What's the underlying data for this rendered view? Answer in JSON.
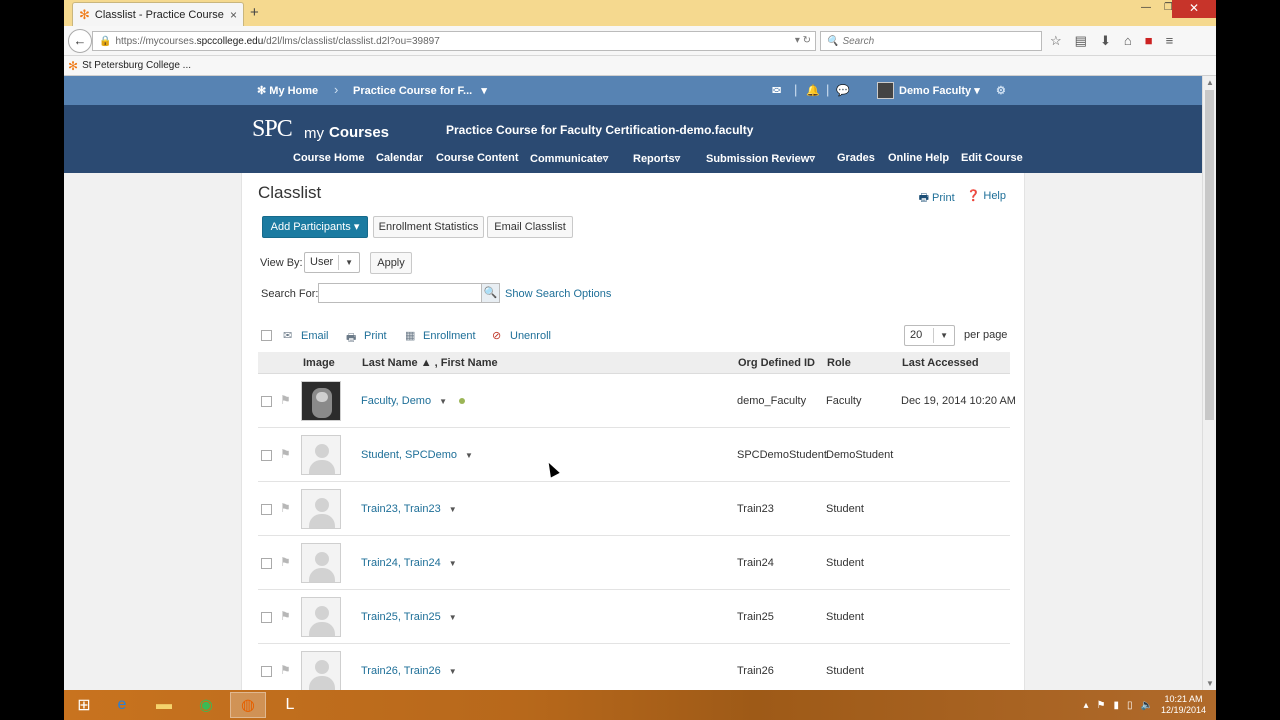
{
  "browser": {
    "tab_title": "Classlist - Practice Course f...",
    "tab_close": "×",
    "new_tab": "+",
    "url_prefix": "https://mycourses.",
    "url_domain": "spccollege.edu",
    "url_path": "/d2l/lms/classlist/classlist.d2l?ou=39897",
    "search_placeholder": "Search",
    "bookmark": "St Petersburg College ..."
  },
  "minibar": {
    "home": "My Home",
    "course": "Practice Course for F...",
    "user": "Demo Faculty"
  },
  "header": {
    "logo_spc": "SPC",
    "logo_my": "my",
    "logo_courses": "Courses",
    "course_title": "Practice Course for Faculty Certification-demo.faculty",
    "nav": [
      "Course Home",
      "Calendar",
      "Course Content",
      "Communicate",
      "Reports",
      "Submission Review",
      "Grades",
      "Online Help",
      "Edit Course"
    ]
  },
  "page": {
    "title": "Classlist",
    "print": "Print",
    "help": "Help",
    "add_participants": "Add Participants",
    "enrollment_statistics": "Enrollment Statistics",
    "email_classlist": "Email Classlist",
    "view_by_label": "View By:",
    "view_by_value": "User",
    "apply": "Apply",
    "search_for_label": "Search For:",
    "search_value": "",
    "show_search_options": "Show Search Options",
    "actions": {
      "email": "Email",
      "print": "Print",
      "enrollment": "Enrollment",
      "unenroll": "Unenroll"
    },
    "per_page_value": "20",
    "per_page_label": "per page",
    "columns": {
      "image": "Image",
      "name": "Last Name ▲ , First Name",
      "org": "Org Defined ID",
      "role": "Role",
      "last_accessed": "Last Accessed"
    },
    "rows": [
      {
        "name": "Faculty, Demo",
        "org": "demo_Faculty",
        "role": "Faculty",
        "last_accessed": "Dec 19, 2014 10:20 AM"
      },
      {
        "name": "Student, SPCDemo",
        "org": "SPCDemoStudent",
        "role": "DemoStudent",
        "last_accessed": ""
      },
      {
        "name": "Train23, Train23",
        "org": "Train23",
        "role": "Student",
        "last_accessed": ""
      },
      {
        "name": "Train24, Train24",
        "org": "Train24",
        "role": "Student",
        "last_accessed": ""
      },
      {
        "name": "Train25, Train25",
        "org": "Train25",
        "role": "Student",
        "last_accessed": ""
      },
      {
        "name": "Train26, Train26",
        "org": "Train26",
        "role": "Student",
        "last_accessed": ""
      }
    ]
  },
  "taskbar": {
    "time": "10:21 AM",
    "date": "12/19/2014"
  }
}
